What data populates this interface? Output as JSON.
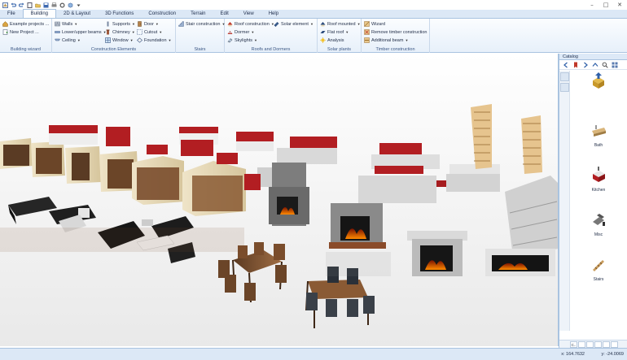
{
  "menu": {
    "tabs": [
      {
        "label": "File",
        "active": false
      },
      {
        "label": "Building",
        "active": true
      },
      {
        "label": "2D & Layout",
        "active": false
      },
      {
        "label": "3D Functions",
        "active": false
      },
      {
        "label": "Construction",
        "active": false
      },
      {
        "label": "Terrain",
        "active": false
      },
      {
        "label": "Edit",
        "active": false
      },
      {
        "label": "View",
        "active": false
      },
      {
        "label": "Help",
        "active": false
      }
    ]
  },
  "ribbon": {
    "wizard": {
      "label": "Building wizard",
      "example": "Example projects ...",
      "new_project": "New Project ..."
    },
    "construction": {
      "label": "Construction Elements",
      "walls": "Walls",
      "beams": "Lower/upper beams",
      "ceiling": "Ceiling",
      "supports": "Supports",
      "chimney": "Chimney",
      "window": "Window",
      "door": "Door",
      "cutout": "Cutout",
      "foundation": "Foundation"
    },
    "stairs": {
      "label": "Stairs",
      "stair_construction": "Stair construction"
    },
    "roofs": {
      "label": "Roofs and Dormers",
      "roof_construction": "Roof construction",
      "solar_element": "Solar element",
      "dormer": "Dormer",
      "skylights": "Skylights"
    },
    "solar": {
      "label": "Solar plants",
      "roof_mounted": "Roof mounted",
      "flat_roof": "Flat roof",
      "analysis": "Analysis"
    },
    "timber": {
      "label": "Timber construction",
      "wizard": "Wizard",
      "remove": "Remove timber construction",
      "additional_beam": "Additional beam"
    }
  },
  "catalog": {
    "title": "Catalog",
    "items": [
      {
        "label": "Bath",
        "icon": "bath-icon"
      },
      {
        "label": "Kitchen",
        "icon": "kitchen-icon"
      },
      {
        "label": "Misc",
        "icon": "misc-icon"
      },
      {
        "label": "Stairs",
        "icon": "stairs-icon"
      }
    ],
    "bottom_tabs": [
      "C..",
      "",
      "",
      "",
      "",
      ""
    ]
  },
  "status": {
    "x": "x: 164.7632",
    "y": "y: -24.0069"
  },
  "colors": {
    "ribbon_bg": "#e7f0fa",
    "menubar_bg": "#dce8f6",
    "kitchen_red": "#b21e22",
    "wood": "#8a5a34",
    "fireplace_stone": "#7d7d7d"
  }
}
